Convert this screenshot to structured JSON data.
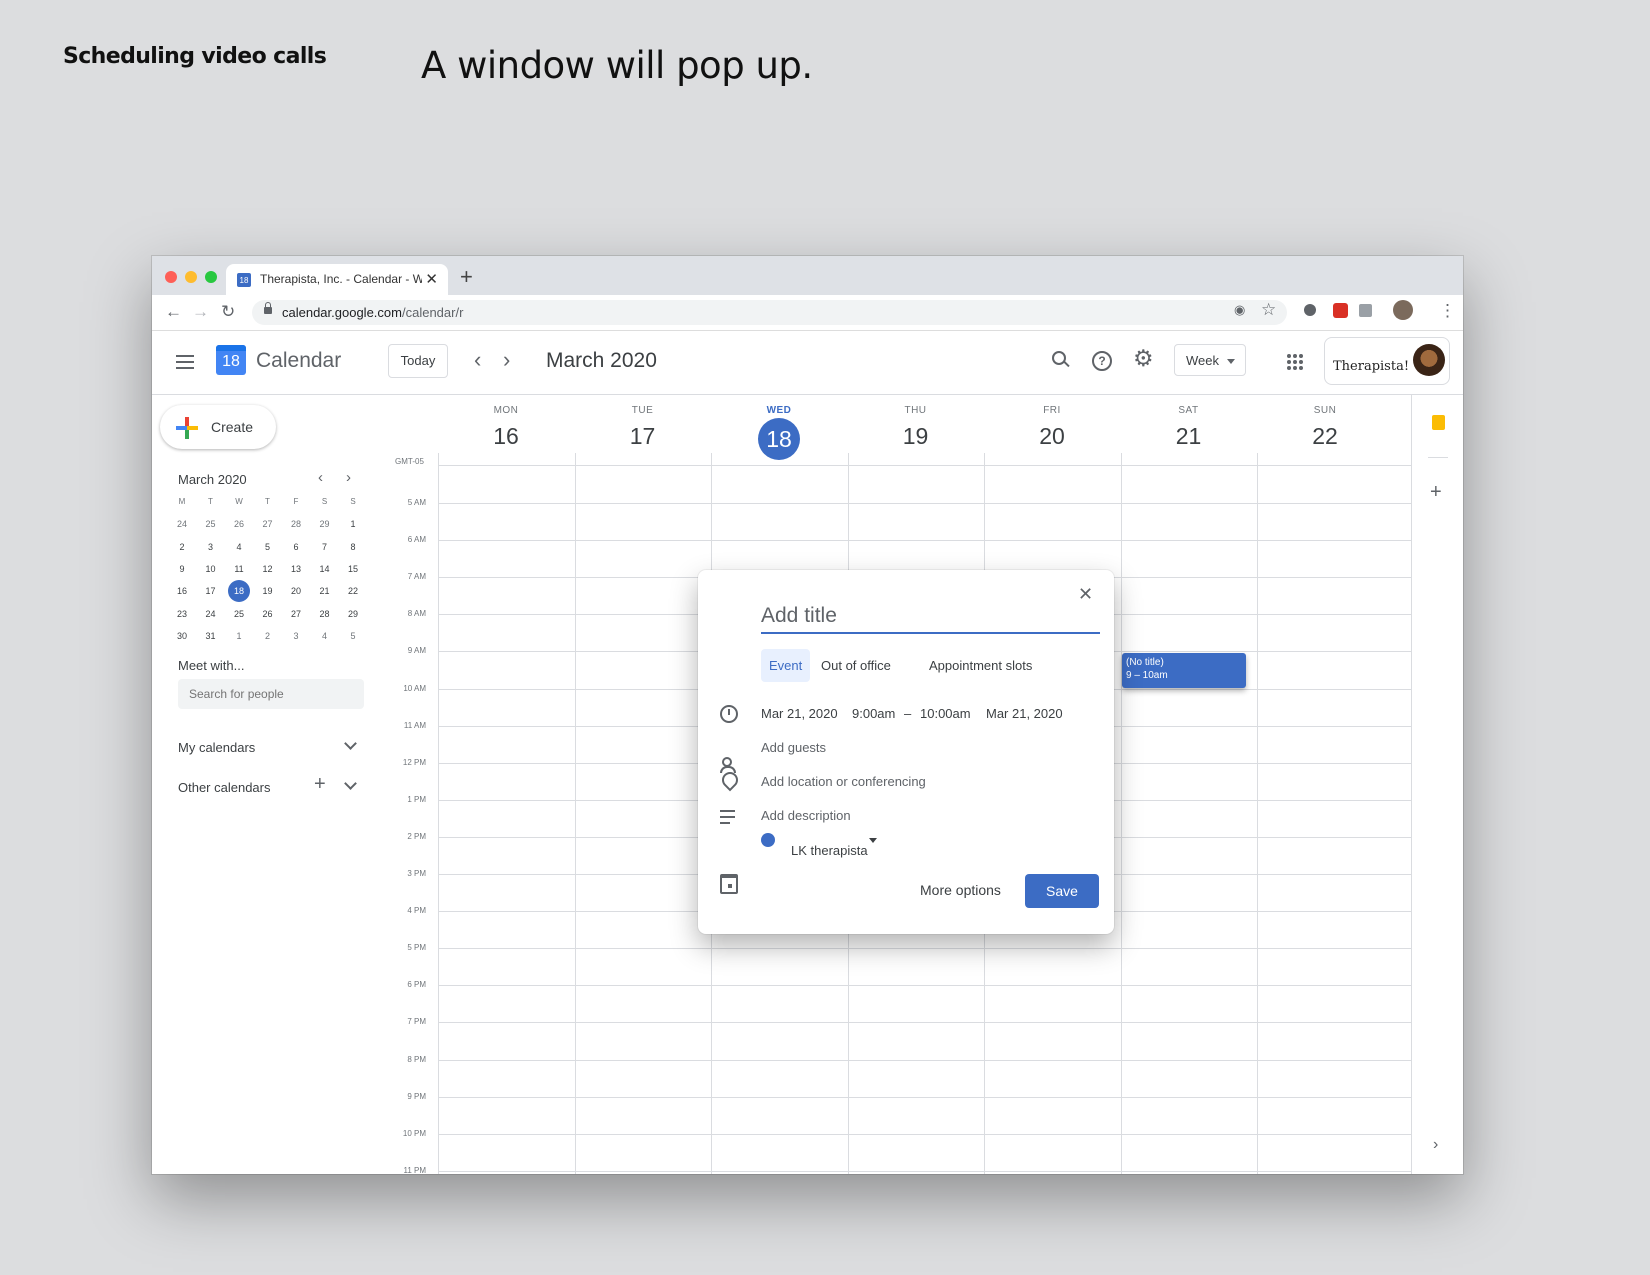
{
  "slide": {
    "label": "Scheduling video calls",
    "heading": "A window will pop up."
  },
  "browser": {
    "tab_title": "Therapista, Inc. - Calendar - Week",
    "tab_icon_text": "18",
    "url_host": "calendar.google.com",
    "url_path": "/calendar/r"
  },
  "app": {
    "logo_number": "18",
    "name": "Calendar",
    "today_label": "Today",
    "period": "March 2020",
    "view_label": "Week",
    "brand_text": "Therapista!"
  },
  "sidebar": {
    "create_label": "Create",
    "mini_calendar": {
      "title": "March 2020",
      "weekday_headers": [
        "M",
        "T",
        "W",
        "T",
        "F",
        "S",
        "S"
      ],
      "weeks": [
        [
          "24",
          "25",
          "26",
          "27",
          "28",
          "29",
          "1"
        ],
        [
          "2",
          "3",
          "4",
          "5",
          "6",
          "7",
          "8"
        ],
        [
          "9",
          "10",
          "11",
          "12",
          "13",
          "14",
          "15"
        ],
        [
          "16",
          "17",
          "18",
          "19",
          "20",
          "21",
          "22"
        ],
        [
          "23",
          "24",
          "25",
          "26",
          "27",
          "28",
          "29"
        ],
        [
          "30",
          "31",
          "1",
          "2",
          "3",
          "4",
          "5"
        ]
      ],
      "selected": "18"
    },
    "meet_with": "Meet with...",
    "search_people_placeholder": "Search for people",
    "my_calendars": "My calendars",
    "other_calendars": "Other calendars"
  },
  "week": {
    "timezone": "GMT-05",
    "days": [
      {
        "name": "MON",
        "num": "16",
        "today": false
      },
      {
        "name": "TUE",
        "num": "17",
        "today": false
      },
      {
        "name": "WED",
        "num": "18",
        "today": true
      },
      {
        "name": "THU",
        "num": "19",
        "today": false
      },
      {
        "name": "FRI",
        "num": "20",
        "today": false
      },
      {
        "name": "SAT",
        "num": "21",
        "today": false
      },
      {
        "name": "SUN",
        "num": "22",
        "today": false
      }
    ],
    "hours": [
      "5 AM",
      "6 AM",
      "7 AM",
      "8 AM",
      "9 AM",
      "10 AM",
      "11 AM",
      "12 PM",
      "1 PM",
      "2 PM",
      "3 PM",
      "4 PM",
      "5 PM",
      "6 PM",
      "7 PM",
      "8 PM",
      "9 PM",
      "10 PM",
      "11 PM"
    ]
  },
  "event_chip": {
    "title": "(No title)",
    "time": "9 – 10am"
  },
  "dialog": {
    "title_placeholder": "Add title",
    "tabs": [
      "Event",
      "Out of office",
      "Appointment slots"
    ],
    "active_tab": "Event",
    "start_date": "Mar 21, 2020",
    "start_time": "9:00am",
    "time_separator": "–",
    "end_time": "10:00am",
    "end_date": "Mar 21, 2020",
    "add_guests": "Add guests",
    "add_location": "Add location or conferencing",
    "add_description": "Add description",
    "calendar_name": "LK therapista",
    "calendar_color": "#3c6cc4",
    "more_options": "More options",
    "save": "Save"
  },
  "colors": {
    "accent": "#3c6cc4",
    "background": "#dcdddf"
  }
}
